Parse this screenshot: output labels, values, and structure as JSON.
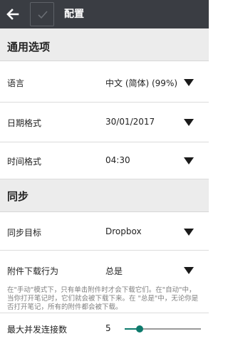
{
  "topbar": {
    "title": "配置",
    "back_icon": "back-arrow-icon",
    "save_icon": "checkmark-icon",
    "background_color": "#3a3d43"
  },
  "sections": {
    "general": {
      "title": "通用选项"
    },
    "sync": {
      "title": "同步"
    }
  },
  "settings": {
    "language": {
      "label": "语言",
      "value": "中文 (简体) (99%)"
    },
    "date_format": {
      "label": "日期格式",
      "value": "30/01/2017"
    },
    "time_format": {
      "label": "时间格式",
      "value": "04:30"
    },
    "sync_target": {
      "label": "同步目标",
      "value": "Dropbox"
    },
    "attachment_download": {
      "label": "附件下载行为",
      "value": "总是",
      "help": "在\"手动\"模式下，只有单击附件时才会下载它们。在\"自动\"中，当你打开笔记时，它们就会被下载下来。在 \"总是\"中，无论你是否打开笔记，所有的附件都会被下载。"
    },
    "max_connections": {
      "label": "最大并发连接数",
      "value": "5",
      "slider_fraction": 0.2,
      "accent_color": "#0d7a6c"
    }
  },
  "dropdown_icon": "triangle-down-icon"
}
